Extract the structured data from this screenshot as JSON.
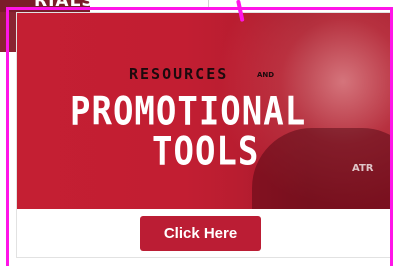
{
  "background": {
    "tile_text": "RIALS"
  },
  "banner": {
    "line1": "RESOURCES",
    "line1_and": "AND",
    "line2": "PROMOTIONAL",
    "line3": "TOOLS",
    "photo_text": "ATR"
  },
  "cta": {
    "label": "Click Here"
  },
  "colors": {
    "brand_red": "#bb1d34",
    "annotation": "#ff14e8"
  }
}
